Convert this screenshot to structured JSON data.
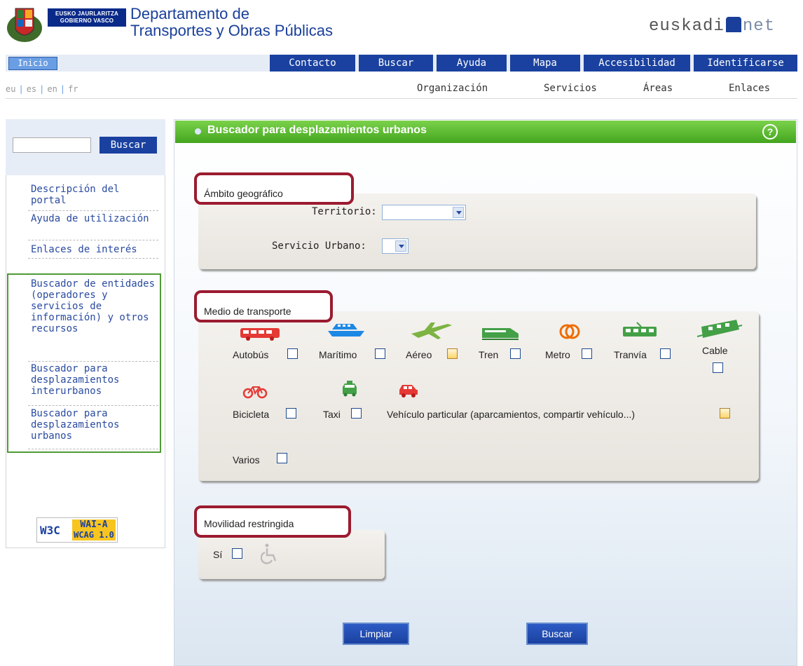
{
  "header": {
    "government_line1": "EUSKO JAURLARITZA",
    "government_line2": "GOBIERNO VASCO",
    "department_line1": "Departamento de",
    "department_line2": "Transportes y Obras Públicas",
    "portal_brand_a": "euskadi",
    "portal_brand_b": "net"
  },
  "topnav": {
    "inicio": "Inicio",
    "items": [
      "Contacto",
      "Buscar",
      "Ayuda",
      "Mapa",
      "Accesibilidad",
      "Identificarse"
    ]
  },
  "languages": [
    "eu",
    "es",
    "en",
    "fr"
  ],
  "subnav": [
    "Organización",
    "Servicios",
    "Áreas",
    "Enlaces"
  ],
  "sidebar": {
    "search_button": "Buscar",
    "search_value": "",
    "links": [
      "Descripción del portal",
      "Ayuda de utilización",
      "Enlaces de interés"
    ],
    "tools": [
      "Buscador de entidades (operadores y servicios de información) y otros recursos",
      "Buscador para desplazamientos interurbanos",
      "Buscador para desplazamientos urbanos"
    ],
    "badge_w3c": "W3C",
    "badge_level": "WAI-A",
    "badge_wcag": "WCAG 1.0"
  },
  "panel": {
    "title": "Buscador para desplazamientos urbanos",
    "help": "?",
    "ambito": {
      "legend": "Ámbito geográfico",
      "territorio_label": "Territorio:",
      "territorio_value": "",
      "servicio_label": "Servicio Urbano:",
      "servicio_value": ""
    },
    "medio": {
      "legend": "Medio de transporte",
      "modes": [
        {
          "label": "Autobús",
          "icon": "bus-icon",
          "color": "#e53935"
        },
        {
          "label": "Marítimo",
          "icon": "ship-icon",
          "color": "#1e88e5"
        },
        {
          "label": "Aéreo",
          "icon": "plane-icon",
          "color": "#7cb342"
        },
        {
          "label": "Tren",
          "icon": "train-icon",
          "color": "#43a047"
        },
        {
          "label": "Metro",
          "icon": "metro-icon",
          "color": "#ef6c00"
        },
        {
          "label": "Tranvía",
          "icon": "tram-icon",
          "color": "#43a047"
        },
        {
          "label": "Cable",
          "icon": "cable-car-icon",
          "color": "#43a047"
        },
        {
          "label": "Bicicleta",
          "icon": "bicycle-icon",
          "color": "#e53935"
        },
        {
          "label": "Taxi",
          "icon": "taxi-icon",
          "color": "#43a047"
        },
        {
          "label": "Vehículo particular (aparcamientos, compartir vehículo...)",
          "icon": "car-icon",
          "color": "#e53935"
        },
        {
          "label": "Varios",
          "icon": "",
          "color": ""
        }
      ]
    },
    "movilidad": {
      "legend": "Movilidad restringida",
      "si_label": "Sí",
      "icon": "wheelchair-icon"
    },
    "buttons": {
      "limpiar": "Limpiar",
      "buscar": "Buscar"
    }
  }
}
